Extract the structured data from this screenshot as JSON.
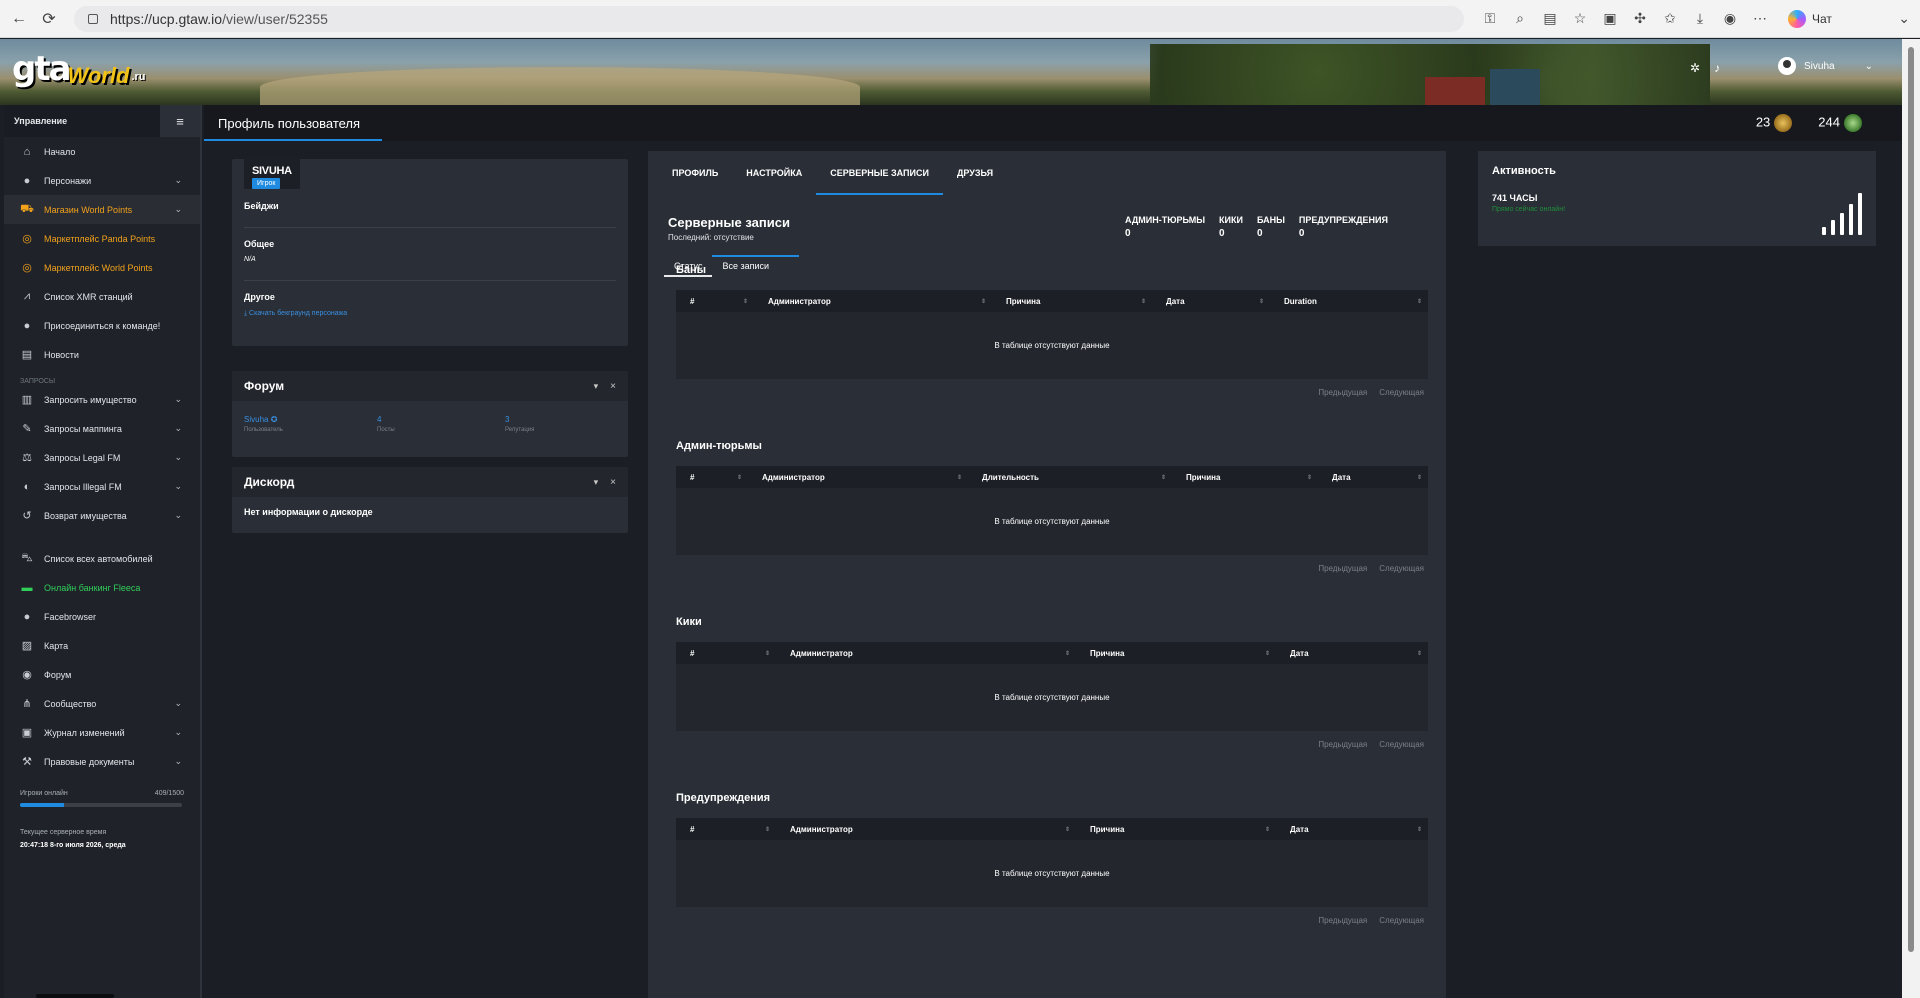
{
  "browser": {
    "url_host": "https://ucp.gtaw.io",
    "url_path": "/view/user/52355",
    "chat_label": "Чат"
  },
  "header": {
    "logo_gta": "gta",
    "logo_world": "World",
    "logo_ru": ".ru",
    "username": "Sivuha"
  },
  "sidebar": {
    "title": "Управление",
    "items": [
      {
        "label": "Начало",
        "icon": "home-icon"
      },
      {
        "label": "Персонажи",
        "icon": "user-icon",
        "chev": "⌄"
      },
      {
        "label": "Магазин World Points",
        "icon": "cart-icon",
        "chev": "⌄"
      },
      {
        "label": "Маркетплейс Panda Points",
        "icon": "coins-icon"
      },
      {
        "label": "Маркетплейс World Points",
        "icon": "coins-icon"
      },
      {
        "label": "Список XMR станций",
        "icon": "antenna-icon"
      },
      {
        "label": "Присоединиться к команде!",
        "icon": "user-plus-icon"
      },
      {
        "label": "Новости",
        "icon": "newspaper-icon"
      }
    ],
    "section_label": "ЗАПРОСЫ",
    "requests": [
      {
        "label": "Запросить имущество",
        "icon": "building-icon",
        "chev": "⌄"
      },
      {
        "label": "Запросы маппинга",
        "icon": "brush-icon",
        "chev": "⌄"
      },
      {
        "label": "Запросы Legal FM",
        "icon": "scales-icon",
        "chev": "⌄"
      },
      {
        "label": "Запросы Illegal FM",
        "icon": "mask-icon",
        "chev": "⌄"
      },
      {
        "label": "Возврат имущества",
        "icon": "undo-icon",
        "chev": "⌄"
      }
    ],
    "other": [
      {
        "label": "Список всех автомобилей",
        "icon": "car-icon"
      },
      {
        "label": "Онлайн банкинг Fleeca",
        "icon": "bank-icon"
      },
      {
        "label": "Facebrowser",
        "icon": "users-icon"
      },
      {
        "label": "Карта",
        "icon": "map-icon"
      },
      {
        "label": "Форум",
        "icon": "chat-icon"
      },
      {
        "label": "Сообщество",
        "icon": "share-icon",
        "chev": "⌄"
      },
      {
        "label": "Журнал изменений",
        "icon": "log-icon",
        "chev": "⌄"
      },
      {
        "label": "Правовые документы",
        "icon": "gavel-icon",
        "chev": "⌄"
      }
    ],
    "online_label": "Игроки онлайн",
    "online_value": "409/1500",
    "online_fraction": 0.2727,
    "server_time_label": "Текущее серверное время",
    "server_time": "20:47:18 8-го июля 2026, среда"
  },
  "subheader": {
    "title": "Профиль пользователя",
    "stat1": "23",
    "stat2": "244"
  },
  "profile": {
    "name": "SIVUHA",
    "role": "Игрок",
    "badges_label": "Бейджи",
    "general_label": "Общее",
    "general_value": "N/A",
    "other_label": "Другое",
    "download_link": "Скачать бекграунд персонажа"
  },
  "forum": {
    "title": "Форум",
    "user": "Sivuha",
    "user_label": "Пользователь",
    "posts": "4",
    "posts_label": "Посты",
    "rep": "3",
    "rep_label": "Репутация"
  },
  "discord": {
    "title": "Дискорд",
    "text": "Нет информации о дискорде"
  },
  "tabs": [
    "ПРОФИЛЬ",
    "НАСТРОЙКА",
    "СЕРВЕРНЫЕ ЗАПИСИ",
    "ДРУЗЬЯ"
  ],
  "records": {
    "title": "Серверные записи",
    "last": "Последний: отсутствие",
    "counters": [
      {
        "k": "АДМИН-ТЮРЬМЫ",
        "v": "0"
      },
      {
        "k": "КИКИ",
        "v": "0"
      },
      {
        "k": "БАНЫ",
        "v": "0"
      },
      {
        "k": "ПРЕДУПРЕЖДЕНИЯ",
        "v": "0"
      }
    ],
    "subtab1": "Статус",
    "subtab2": "Все записи",
    "empty": "В таблице отсутствуют данные",
    "prev": "Предыдущая",
    "next": "Следующая",
    "sections": [
      {
        "title": "Баны",
        "cols": [
          "#",
          "Администратор",
          "Причина",
          "Дата",
          "Duration"
        ]
      },
      {
        "title": "Админ-тюрьмы",
        "cols": [
          "#",
          "Администратор",
          "Длительность",
          "Причина",
          "Дата"
        ]
      },
      {
        "title": "Кики",
        "cols": [
          "#",
          "Администратор",
          "Причина",
          "Дата"
        ]
      },
      {
        "title": "Предупреждения",
        "cols": [
          "#",
          "Администратор",
          "Причина",
          "Дата"
        ]
      }
    ]
  },
  "activity": {
    "title": "Активность",
    "hours": "741 ЧАСЫ",
    "status": "Прямо сейчас онлайн!"
  }
}
